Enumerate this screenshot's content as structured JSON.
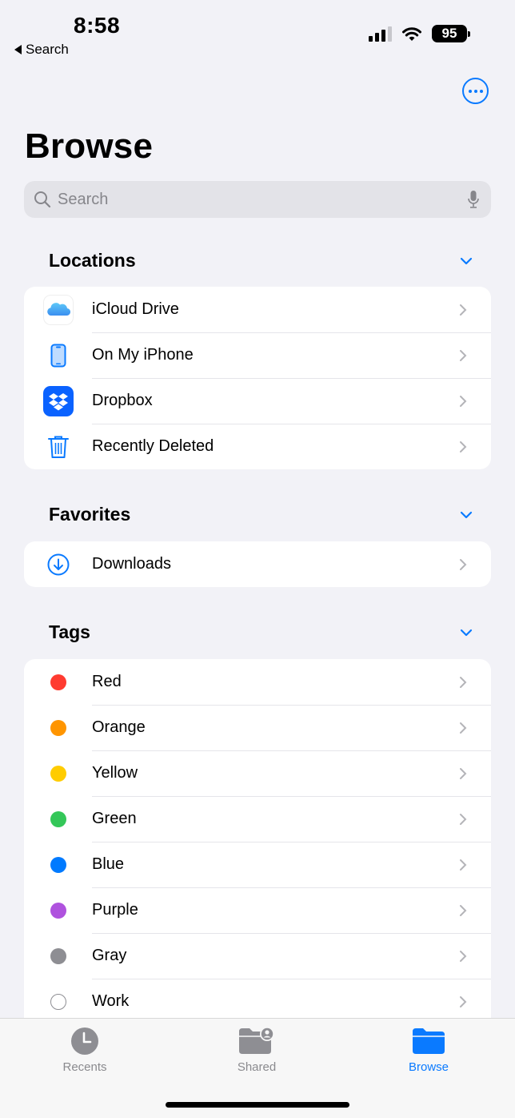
{
  "status_bar": {
    "time": "8:58",
    "back_label": "Search",
    "battery": "95",
    "signal_bars_active": 3,
    "signal_bars_total": 4
  },
  "header": {
    "more_icon": "ellipsis-circle-icon",
    "title": "Browse"
  },
  "search": {
    "placeholder": "Search",
    "icon": "magnifying-glass-icon",
    "mic_icon": "microphone-icon"
  },
  "sections": {
    "locations": {
      "label": "Locations",
      "items": [
        {
          "label": "iCloud Drive",
          "icon": "icloud-icon"
        },
        {
          "label": "On My iPhone",
          "icon": "iphone-icon"
        },
        {
          "label": "Dropbox",
          "icon": "dropbox-icon"
        },
        {
          "label": "Recently Deleted",
          "icon": "trash-icon"
        }
      ]
    },
    "favorites": {
      "label": "Favorites",
      "items": [
        {
          "label": "Downloads",
          "icon": "download-circle-icon"
        }
      ]
    },
    "tags": {
      "label": "Tags",
      "items": [
        {
          "label": "Red",
          "color": "#ff3b30"
        },
        {
          "label": "Orange",
          "color": "#ff9500"
        },
        {
          "label": "Yellow",
          "color": "#ffcc00"
        },
        {
          "label": "Green",
          "color": "#34c759"
        },
        {
          "label": "Blue",
          "color": "#007aff"
        },
        {
          "label": "Purple",
          "color": "#af52de"
        },
        {
          "label": "Gray",
          "color": "#8e8e93"
        },
        {
          "label": "Work",
          "color": "none"
        }
      ]
    }
  },
  "tab_bar": {
    "tabs": [
      {
        "label": "Recents",
        "icon": "clock-icon",
        "active": false
      },
      {
        "label": "Shared",
        "icon": "shared-folder-icon",
        "active": false
      },
      {
        "label": "Browse",
        "icon": "folder-icon",
        "active": true
      }
    ]
  },
  "colors": {
    "accent": "#0a7aff",
    "background": "#f2f2f7",
    "inactive_tab": "#8a8a8e"
  }
}
